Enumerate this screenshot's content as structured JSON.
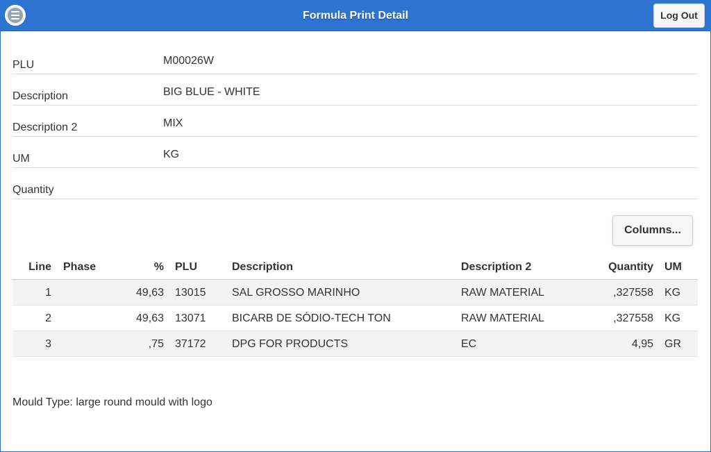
{
  "header": {
    "title": "Formula Print Detail",
    "logout_label": "Log Out",
    "menu_icon": "menu-icon",
    "accent_color": "#2d74d0"
  },
  "fields": [
    {
      "label": "PLU",
      "value": "M00026W"
    },
    {
      "label": "Description",
      "value": "BIG BLUE - WHITE"
    },
    {
      "label": "Description 2",
      "value": "MIX"
    },
    {
      "label": "UM",
      "value": "KG"
    },
    {
      "label": "Quantity",
      "value": ""
    }
  ],
  "columns_button_label": "Columns...",
  "table": {
    "headers": {
      "line": "Line",
      "phase": "Phase",
      "pct": "%",
      "plu": "PLU",
      "description": "Description",
      "description2": "Description 2",
      "quantity": "Quantity",
      "um": "UM"
    },
    "rows": [
      {
        "line": "1",
        "phase": "",
        "pct": "49,63",
        "plu": "13015",
        "description": "SAL GROSSO MARINHO",
        "description2": "RAW MATERIAL",
        "quantity": ",327558",
        "um": "KG"
      },
      {
        "line": "2",
        "phase": "",
        "pct": "49,63",
        "plu": "13071",
        "description": "BICARB DE SÓDIO-TECH TON",
        "description2": "RAW MATERIAL",
        "quantity": ",327558",
        "um": "KG"
      },
      {
        "line": "3",
        "phase": "",
        "pct": ",75",
        "plu": "37172",
        "description": "DPG FOR PRODUCTS",
        "description2": "EC",
        "quantity": "4,95",
        "um": "GR"
      }
    ]
  },
  "mould_type": "Mould Type: large round mould with logo"
}
